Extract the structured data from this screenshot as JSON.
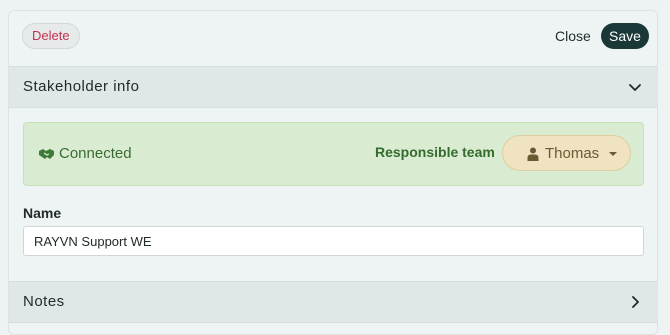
{
  "toolbar": {
    "delete_label": "Delete",
    "close_label": "Close",
    "save_label": "Save"
  },
  "stakeholder": {
    "title": "Stakeholder info",
    "expanded": true,
    "status_icon": "handshake-icon",
    "status_text": "Connected",
    "responsible_label": "Responsible team",
    "responsible_user": "Thomas",
    "user_icon": "person-icon"
  },
  "name_field": {
    "label": "Name",
    "value": "RAYVN Support WE"
  },
  "notes": {
    "title": "Notes",
    "expanded": false
  },
  "colors": {
    "save_bg": "#1a3838",
    "delete_text": "#c7314f",
    "connected_bg": "#d9ecd2",
    "connected_text": "#3a6b34",
    "user_chip_bg": "#f0e3c2"
  }
}
